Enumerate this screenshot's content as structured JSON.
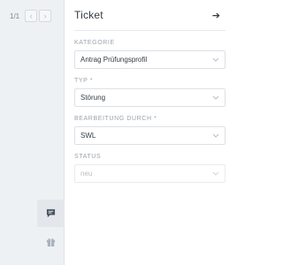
{
  "pager": {
    "count": "1/1",
    "prev_icon": "chevron-left-icon",
    "next_icon": "chevron-right-icon"
  },
  "rail": {
    "icons": [
      "chat-icon",
      "gift-icon"
    ]
  },
  "panel": {
    "title": "Ticket",
    "header_icon": "arrow-right-icon",
    "fields": [
      {
        "label": "KATEGORIE",
        "value": "Antrag Prüfungsprofil",
        "disabled": false
      },
      {
        "label": "TYP *",
        "value": "Störung",
        "disabled": false
      },
      {
        "label": "BEARBEITUNG DURCH *",
        "value": "SWL",
        "disabled": false
      },
      {
        "label": "STATUS",
        "value": "neu",
        "disabled": true
      }
    ]
  },
  "colors": {
    "rail_bg": "#eef1f4",
    "text": "#333b44",
    "label": "#9aa3ad",
    "border": "#dde1e6"
  }
}
